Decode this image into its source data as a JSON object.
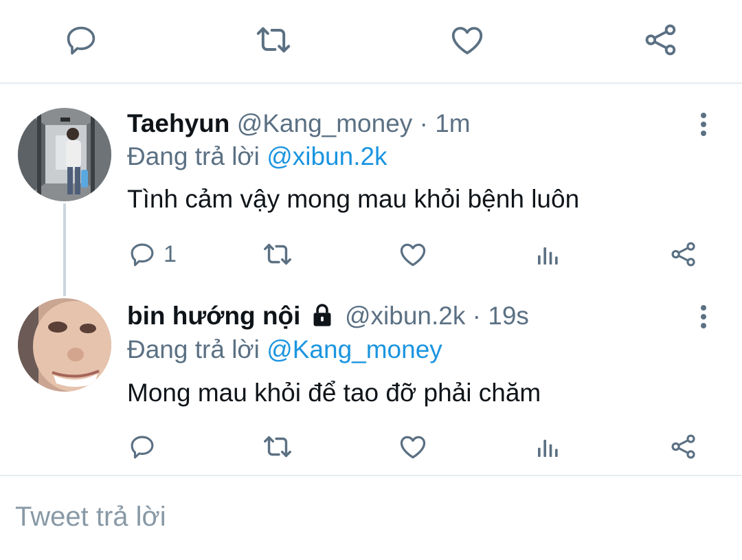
{
  "top_actions": {
    "icons": [
      "reply-icon",
      "retweet-icon",
      "like-icon",
      "share-icon"
    ],
    "icon_color": "#5b7083"
  },
  "tweets": [
    {
      "name": "Taehyun",
      "handle": "@Kang_money",
      "separator": "·",
      "time": "1m",
      "replying_prefix": "Đang trả lời",
      "replying_to": "@xibun.2k",
      "text": "Tình cảm vậy mong mau khỏi bệnh luôn",
      "reply_count": "1",
      "avatar": "photo of a person taking a mirror selfie in a hallway"
    },
    {
      "name": "bin hướng nội",
      "locked": true,
      "handle": "@xibun.2k",
      "separator": "·",
      "time": "19s",
      "replying_prefix": "Đang trả lời",
      "replying_to": "@Kang_money",
      "text": "Mong mau khỏi để tao đỡ phải chăm",
      "reply_count": "",
      "avatar": "close-up photo of a face"
    }
  ],
  "reply_box": {
    "placeholder": "Tweet trả lời",
    "value": ""
  },
  "colors": {
    "text": "#0f1419",
    "muted": "#5b7083",
    "link": "#1b95e0",
    "divider": "#e6ecf0",
    "thread_line": "#ccd6dd"
  }
}
